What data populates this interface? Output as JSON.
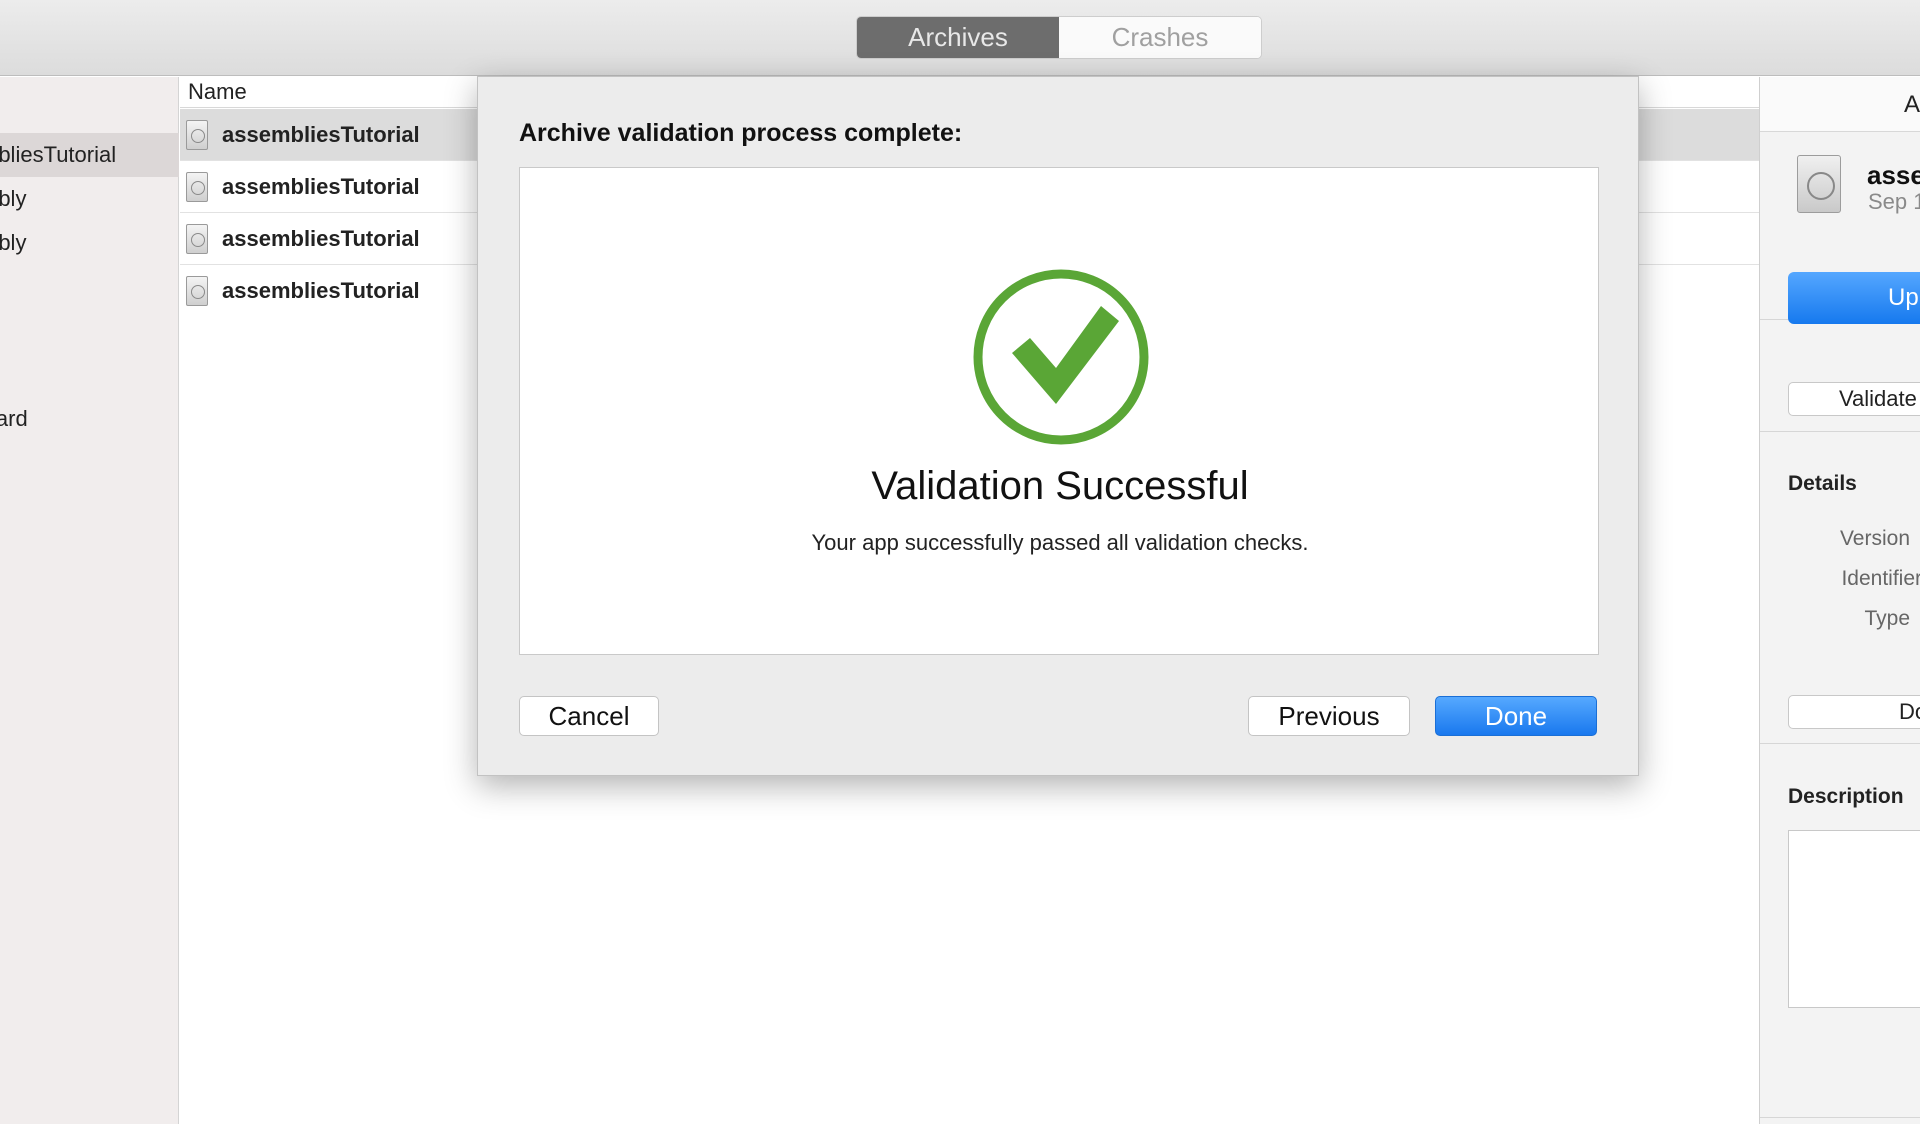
{
  "toolbar": {
    "tabs": [
      {
        "label": "Archives",
        "active": true
      },
      {
        "label": "Crashes",
        "active": false
      }
    ]
  },
  "sidebar": {
    "items": [
      {
        "label": "mbliesTutorial",
        "selected": true
      },
      {
        "label": "mbly",
        "selected": false
      },
      {
        "label": "mbly",
        "selected": false
      },
      {
        "label": "ward",
        "selected": false
      }
    ]
  },
  "list": {
    "column_header": "Name",
    "rows": [
      {
        "name": "assembliesTutorial",
        "selected": true
      },
      {
        "name": "assembliesTutorial",
        "selected": false
      },
      {
        "name": "assembliesTutorial",
        "selected": false
      },
      {
        "name": "assembliesTutorial",
        "selected": false
      }
    ]
  },
  "inspector": {
    "top_text": "A",
    "archive_name": "asse",
    "archive_date": "Sep 1",
    "upload_button": "Up",
    "validate_button": "Validate",
    "details_heading": "Details",
    "details_labels": [
      "Version",
      "Identifier",
      "Type"
    ],
    "d_button": "Do",
    "description_heading": "Description"
  },
  "sheet": {
    "title": "Archive validation process complete:",
    "success_title": "Validation Successful",
    "success_message": "Your app successfully passed all validation checks.",
    "check_color": "#5aa636",
    "buttons": {
      "cancel": "Cancel",
      "previous": "Previous",
      "done": "Done"
    }
  }
}
